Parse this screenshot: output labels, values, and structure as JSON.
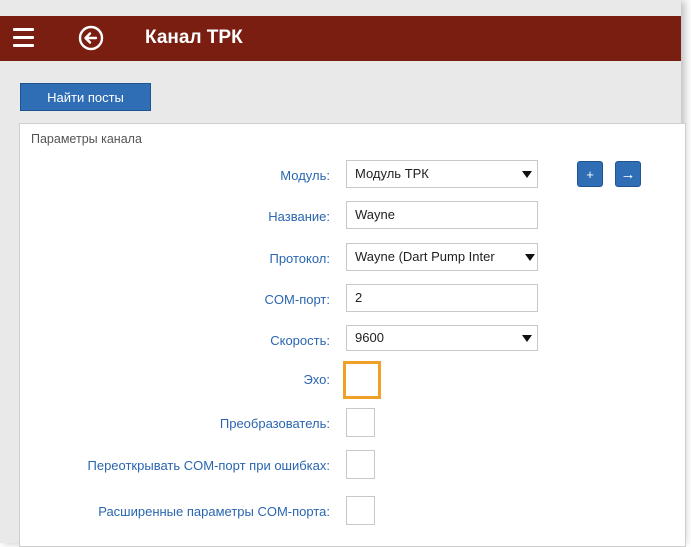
{
  "header": {
    "title": "Канал ТРК",
    "background": "#7a1e12"
  },
  "toolbar": {
    "find_posts_label": "Найти посты"
  },
  "panel": {
    "title": "Параметры канала",
    "fields": {
      "module_label": "Модуль:",
      "module_value": "Модуль ТРК",
      "name_label": "Название:",
      "name_value": "Wayne",
      "protocol_label": "Протокол:",
      "protocol_value": "Wayne (Dart Pump Inter",
      "comport_label": "COM-порт:",
      "comport_value": "2",
      "speed_label": "Скорость:",
      "speed_value": "9600",
      "echo_label": "Эхо:",
      "converter_label": "Преобразователь:",
      "reopen_label": "Переоткрывать COM-порт при ошибках:",
      "extended_label": "Расширенные параметры COM-порта:"
    },
    "buttons": {
      "add_symbol": "+",
      "go_symbol": "→"
    }
  },
  "icons": {
    "menu": "hamburger-menu-icon",
    "back": "circle-arrow-left-icon",
    "dropdown": "triangle-down-icon"
  },
  "colors": {
    "accent": "#2f6db5",
    "label": "#2a66b0",
    "focus": "#f0a028"
  }
}
